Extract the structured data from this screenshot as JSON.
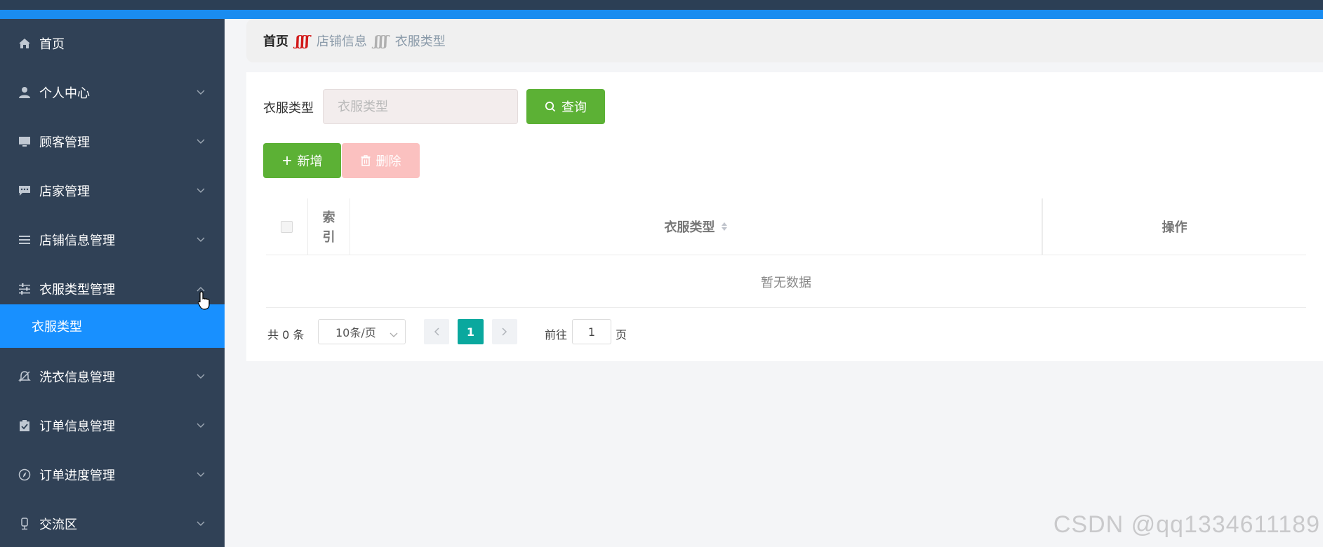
{
  "sidebar": {
    "items": [
      {
        "label": "首页",
        "icon": "home-icon",
        "chevron": ""
      },
      {
        "label": "个人中心",
        "icon": "user-icon",
        "chevron": "down"
      },
      {
        "label": "顾客管理",
        "icon": "monitor-icon",
        "chevron": "down"
      },
      {
        "label": "店家管理",
        "icon": "message-icon",
        "chevron": "down"
      },
      {
        "label": "店铺信息管理",
        "icon": "list-icon",
        "chevron": "down"
      },
      {
        "label": "衣服类型管理",
        "icon": "sliders-icon",
        "chevron": "up"
      },
      {
        "label": "洗衣信息管理",
        "icon": "bell-off-icon",
        "chevron": "down"
      },
      {
        "label": "订单信息管理",
        "icon": "clipboard-icon",
        "chevron": "down"
      },
      {
        "label": "订单进度管理",
        "icon": "compass-icon",
        "chevron": "down"
      },
      {
        "label": "交流区",
        "icon": "microphone-icon",
        "chevron": "down"
      }
    ],
    "active_sub_item": "衣服类型"
  },
  "breadcrumb": {
    "home": "首页",
    "level1": "店铺信息",
    "level2": "衣服类型",
    "separator": "ʃʃʃ"
  },
  "search": {
    "label": "衣服类型",
    "placeholder": "衣服类型",
    "query_button": "查询"
  },
  "actions": {
    "add_button": "新增",
    "delete_button": "删除"
  },
  "table": {
    "index_header_line1": "索",
    "index_header_line2": "引",
    "type_header": "衣服类型",
    "ops_header": "操作",
    "empty_text": "暂无数据"
  },
  "pagination": {
    "total": "共 0 条",
    "page_size": "10条/页",
    "current_page": "1",
    "goto_label": "前往",
    "goto_value": "1",
    "page_suffix": "页"
  },
  "watermark": "CSDN @qq1334611189",
  "colors": {
    "sidebar_bg": "#304156",
    "active_blue": "#1890ff",
    "query_green": "#5cb135",
    "delete_pink": "#fbc1c0",
    "page_teal": "#0aa89e"
  }
}
